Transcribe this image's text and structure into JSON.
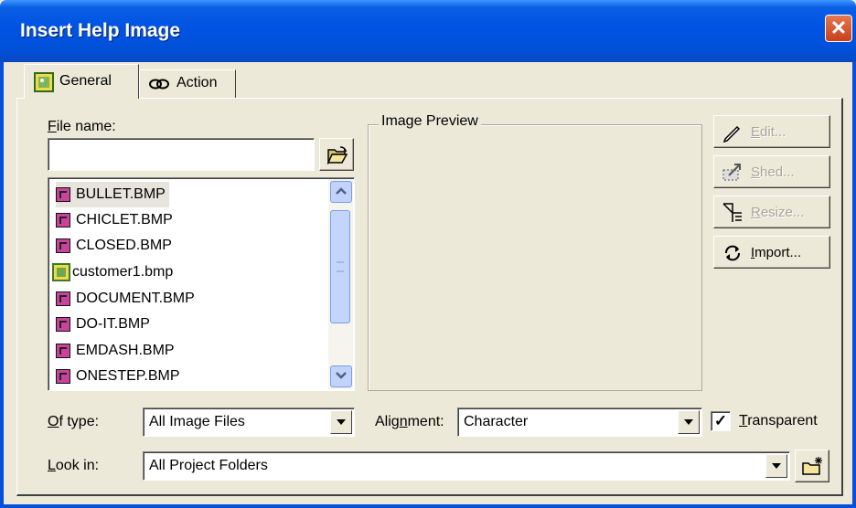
{
  "window": {
    "title": "Insert Help Image",
    "close_glyph": "✕"
  },
  "tabs": [
    {
      "label": "General",
      "icon": "image-icon",
      "selected": true
    },
    {
      "label": "Action",
      "icon": "chain-link-icon",
      "selected": false
    }
  ],
  "file_name": {
    "label_prefix": "F",
    "label_rest": "ile name:",
    "value": ""
  },
  "file_list": [
    {
      "name": "BULLET.BMP",
      "icon": "bmp-file-icon",
      "selected": true
    },
    {
      "name": "CHICLET.BMP",
      "icon": "bmp-file-icon"
    },
    {
      "name": "CLOSED.BMP",
      "icon": "bmp-file-icon"
    },
    {
      "name": "customer1.bmp",
      "icon": "image-file-icon"
    },
    {
      "name": "DOCUMENT.BMP",
      "icon": "bmp-file-icon"
    },
    {
      "name": "DO-IT.BMP",
      "icon": "bmp-file-icon"
    },
    {
      "name": "EMDASH.BMP",
      "icon": "bmp-file-icon"
    },
    {
      "name": "ONESTEP.BMP",
      "icon": "bmp-file-icon"
    }
  ],
  "image_preview": {
    "label": "Image Preview"
  },
  "buttons": {
    "edit": {
      "prefix": "",
      "underlined": "E",
      "suffix": "dit...",
      "enabled": false
    },
    "shed": {
      "prefix": "",
      "underlined": "S",
      "suffix": "hed...",
      "enabled": false
    },
    "resize": {
      "prefix": "",
      "underlined": "R",
      "suffix": "esize...",
      "enabled": false
    },
    "import": {
      "prefix": "",
      "underlined": "I",
      "suffix": "mport...",
      "enabled": true
    }
  },
  "of_type": {
    "label_prefix": "O",
    "label_rest": "f type:",
    "value": "All Image Files"
  },
  "alignment": {
    "label_pre": "Alig",
    "label_u": "n",
    "label_post": "ment:",
    "value": "Character"
  },
  "transparent": {
    "label_prefix": "T",
    "label_rest": "ransparent",
    "checked": true,
    "check_glyph": "✓"
  },
  "look_in": {
    "label_prefix": "L",
    "label_rest": "ook in:",
    "value": "All Project Folders"
  },
  "colors": {
    "title_bar": "#0054e3",
    "dialog_bg": "#ece9d8",
    "close_button": "#d4502a",
    "selection": "#e6e4dc"
  }
}
